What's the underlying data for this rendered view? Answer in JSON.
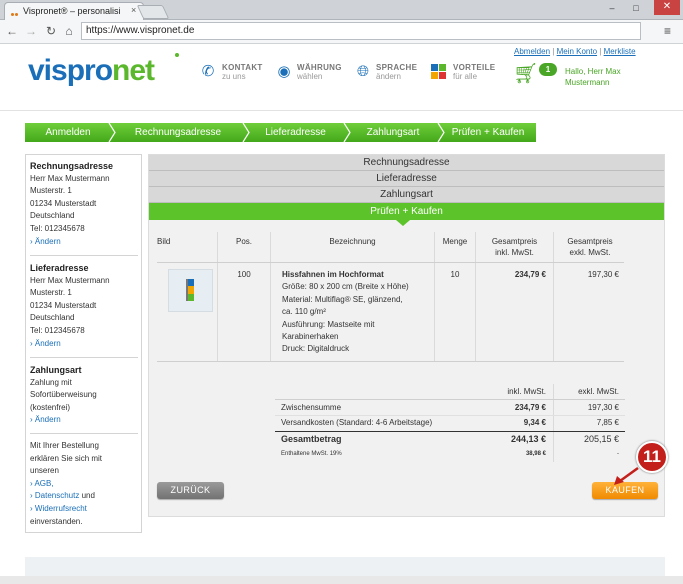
{
  "browser": {
    "tab_title": "Vispronet® – personalisi",
    "tab_close": "×",
    "url": "https://www.vispronet.de",
    "win_min": "–",
    "win_max": "□",
    "win_close": "✕"
  },
  "header": {
    "logo_part1": "vispro",
    "logo_part2": "net",
    "items": [
      {
        "title": "KONTAKT",
        "sub": "zu uns",
        "icon": "phone-icon"
      },
      {
        "title": "WÄHRUNG",
        "sub": "wählen",
        "icon": "coins-icon"
      },
      {
        "title": "SPRACHE",
        "sub": "ändern",
        "icon": "globe-icon"
      },
      {
        "title": "VORTEILE",
        "sub": "für alle",
        "icon": "puzzle-icon"
      }
    ],
    "links": {
      "logout": "Abmelden",
      "account": "Mein Konto",
      "wishlist": "Merkliste",
      "sep": "|"
    },
    "cart_count": "1",
    "greeting": "Hallo, Herr Max Mustermann"
  },
  "steps": [
    "Anmelden",
    "Rechnungsadresse",
    "Lieferadresse",
    "Zahlungsart",
    "Prüfen + Kaufen"
  ],
  "sidebar": {
    "billing": {
      "title": "Rechnungsadresse",
      "lines": [
        "Herr Max Mustermann",
        "Musterstr. 1",
        "01234 Musterstadt",
        "Deutschland",
        "Tel: 012345678"
      ],
      "change": "› Ändern"
    },
    "shipping": {
      "title": "Lieferadresse",
      "lines": [
        "Herr Max Mustermann",
        "Musterstr. 1",
        "01234 Musterstadt",
        "Deutschland",
        "Tel: 012345678"
      ],
      "change": "› Ändern"
    },
    "payment": {
      "title": "Zahlungsart",
      "lines": [
        "Zahlung mit",
        "Sofortüberweisung",
        "(kostenfrei)"
      ],
      "change": "› Ändern"
    },
    "consent": {
      "lines": [
        "Mit Ihrer Bestellung",
        "erklären Sie sich mit",
        "unseren"
      ],
      "agb": "› AGB,",
      "privacy": "› Datenschutz",
      "and": " und",
      "withdrawal": "› Widerrufsrecht",
      "end": "einverstanden."
    }
  },
  "accordion": [
    "Rechnungsadresse",
    "Lieferadresse",
    "Zahlungsart",
    "Prüfen + Kaufen"
  ],
  "table": {
    "headers": {
      "image": "Bild",
      "pos": "Pos.",
      "desc": "Bezeichnung",
      "qty": "Menge",
      "gross_1": "Gesamtpreis",
      "gross_2": "inkl. MwSt.",
      "net_1": "Gesamtpreis",
      "net_2": "exkl. MwSt."
    },
    "row": {
      "pos": "100",
      "name": "Hissfahnen im Hochformat",
      "details": [
        "Größe: 80 x 200 cm (Breite x Höhe)",
        "Material: Multiflag® SE, glänzend,",
        "ca. 110 g/m²",
        "Ausführung: Mastseite mit",
        "Karabinerhaken",
        "Druck: Digitaldruck"
      ],
      "qty": "10",
      "gross": "234,79 €",
      "net": "197,30 €"
    }
  },
  "summary": {
    "col_gross": "inkl. MwSt.",
    "col_net": "exkl. MwSt.",
    "rows": [
      {
        "label": "Zwischensumme",
        "gross": "234,79 €",
        "net": "197,30 €"
      },
      {
        "label": "Versandkosten (Standard: 4-6 Arbeitstage)",
        "gross": "9,34 €",
        "net": "7,85 €"
      },
      {
        "label": "Gesamtbetrag",
        "gross": "244,13 €",
        "net": "205,15 €"
      },
      {
        "label": "Enthaltene MwSt. 19%",
        "gross": "38,98 €",
        "net": "-"
      }
    ]
  },
  "buttons": {
    "back": "ZURÜCK",
    "buy": "KAUFEN"
  },
  "marker": "11"
}
